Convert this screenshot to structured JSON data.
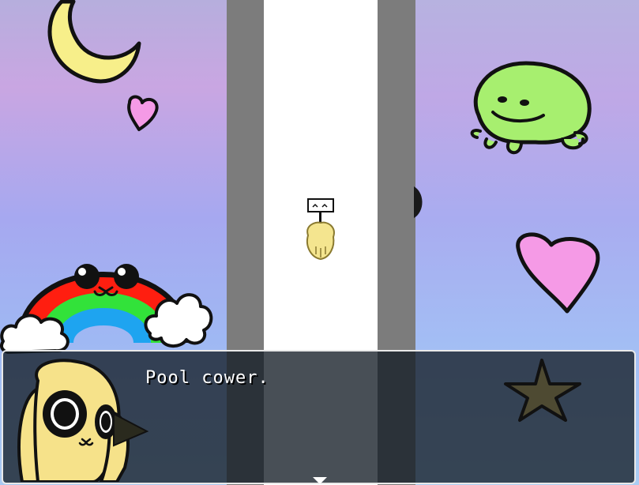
{
  "scene": {
    "colors": {
      "wall": "#7c7c7c",
      "floor": "#ffffff",
      "moon": "#f7ef8a",
      "heart": "#f59ae6",
      "frog": "#a7ef6f",
      "star": "#4e4a32",
      "rainbow_red": "#ff1e10",
      "rainbow_green": "#32e23a",
      "rainbow_blue": "#1ea4f0",
      "cloud": "#ffffff",
      "player": "#f4e58f"
    },
    "decorations": [
      "moon-icon",
      "heart-icon",
      "rainbow-icon",
      "cloud-icon",
      "frog-icon",
      "star-icon"
    ]
  },
  "dialog": {
    "text": "Pool cower.",
    "speaker_portrait": "bunny-portrait-icon",
    "continue_indicator": "down-arrow-icon"
  }
}
